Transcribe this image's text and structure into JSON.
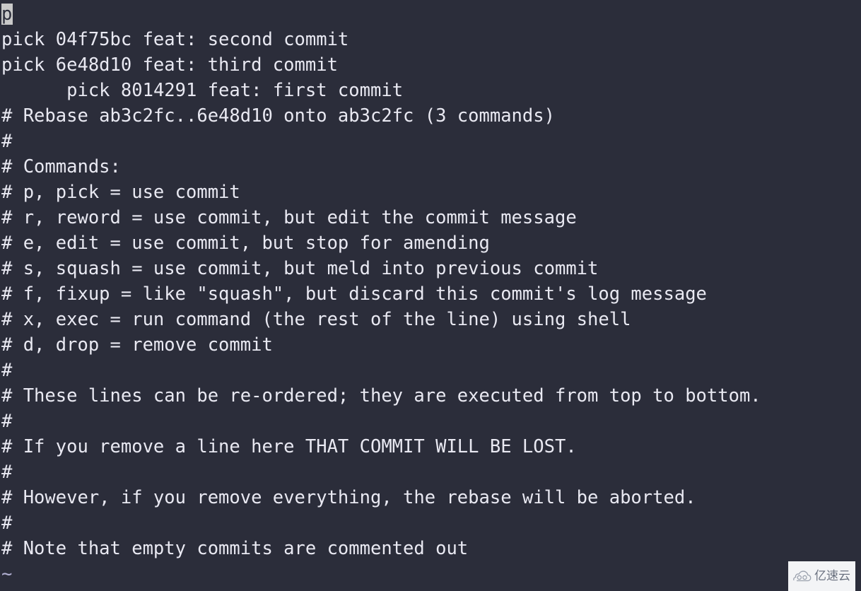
{
  "terminal": {
    "background_color": "#2b2d3a",
    "text_color": "#e9e9f2",
    "tilde_color": "#b2b0d2",
    "cursor_color": "#c9c9c9",
    "cursor_char": "p",
    "cursor_row": 1,
    "cursor_col": 1
  },
  "editor": {
    "todo_lines": [
      "pick 8014291 feat: first commit",
      "pick 04f75bc feat: second commit",
      "pick 6e48d10 feat: third commit"
    ],
    "blank_line": "",
    "comment_lines": [
      "# Rebase ab3c2fc..6e48d10 onto ab3c2fc (3 commands)",
      "#",
      "# Commands:",
      "# p, pick = use commit",
      "# r, reword = use commit, but edit the commit message",
      "# e, edit = use commit, but stop for amending",
      "# s, squash = use commit, but meld into previous commit",
      "# f, fixup = like \"squash\", but discard this commit's log message",
      "# x, exec = run command (the rest of the line) using shell",
      "# d, drop = remove commit",
      "#",
      "# These lines can be re-ordered; they are executed from top to bottom.",
      "#",
      "# If you remove a line here THAT COMMIT WILL BE LOST.",
      "#",
      "# However, if you remove everything, the rebase will be aborted.",
      "#",
      "# Note that empty commits are commented out"
    ],
    "filler_lines": [
      "~"
    ]
  },
  "watermark": {
    "icon": "cloud-icon",
    "text": "亿速云",
    "background_color": "#f3f4f6",
    "foreground_color": "#6b7280"
  }
}
